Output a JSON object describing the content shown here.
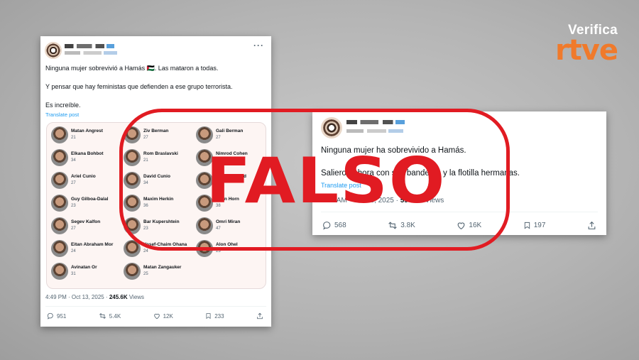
{
  "brand": {
    "verifica": "Verifica",
    "rtve": "rtve",
    "accent": "#f07a2b"
  },
  "stamp": {
    "label": "FALSO",
    "color": "#e11b22"
  },
  "left_tweet": {
    "more": "···",
    "line1": "Ninguna mujer sobrevivió a Hamás 🇵🇸. Las mataron a todas.",
    "line2": "Y pensar que hay feministas que defienden a ese grupo terrorista.",
    "line3": "Es increíble.",
    "translate": "Translate post",
    "people": [
      {
        "name": "Matan Angrest",
        "age": "21"
      },
      {
        "name": "Ziv Berman",
        "age": "27"
      },
      {
        "name": "Gali Berman",
        "age": "27"
      },
      {
        "name": "Elkana Bohbot",
        "age": "34"
      },
      {
        "name": "Rom Braslavski",
        "age": "21"
      },
      {
        "name": "Nimrod Cohen",
        "age": "20"
      },
      {
        "name": "Ariel Cunio",
        "age": "27"
      },
      {
        "name": "David Cunio",
        "age": "34"
      },
      {
        "name": "Evyatar David",
        "age": "24"
      },
      {
        "name": "Guy Gilboa-Dalal",
        "age": "23"
      },
      {
        "name": "Maxim Herkin",
        "age": "36"
      },
      {
        "name": "Eitan Horn",
        "age": "38"
      },
      {
        "name": "Segev Kalfon",
        "age": "27"
      },
      {
        "name": "Bar Kupershtein",
        "age": "23"
      },
      {
        "name": "Omri Miran",
        "age": "47"
      },
      {
        "name": "Eitan Abraham Mor",
        "age": "24"
      },
      {
        "name": "Yosef-Chaim Ohana",
        "age": "24"
      },
      {
        "name": "Alon Ohel",
        "age": "23"
      },
      {
        "name": "Avinatan Or",
        "age": "31"
      },
      {
        "name": "Matan Zangauker",
        "age": "25"
      }
    ],
    "time": "4:49 PM · Oct 13, 2025 · ",
    "views": "245.6K",
    "views_label": " Views",
    "replies": "951",
    "reposts": "5.4K",
    "likes": "12K",
    "bookmarks": "233"
  },
  "right_tweet": {
    "more": "···",
    "line1": "Ninguna mujer ha sobrevivido a Hamás.",
    "line2": "Salieron ahora con sus banderas y la flotilla hermanas.",
    "translate": "Translate post",
    "time": "7:28 AM · Oct 13, 2025 · ",
    "views": "594.9K",
    "views_label": " Views",
    "replies": "568",
    "reposts": "3.8K",
    "likes": "16K",
    "bookmarks": "197"
  },
  "icons": [
    "reply-icon",
    "repost-icon",
    "like-icon",
    "bookmark-icon",
    "share-icon",
    "more-icon"
  ]
}
